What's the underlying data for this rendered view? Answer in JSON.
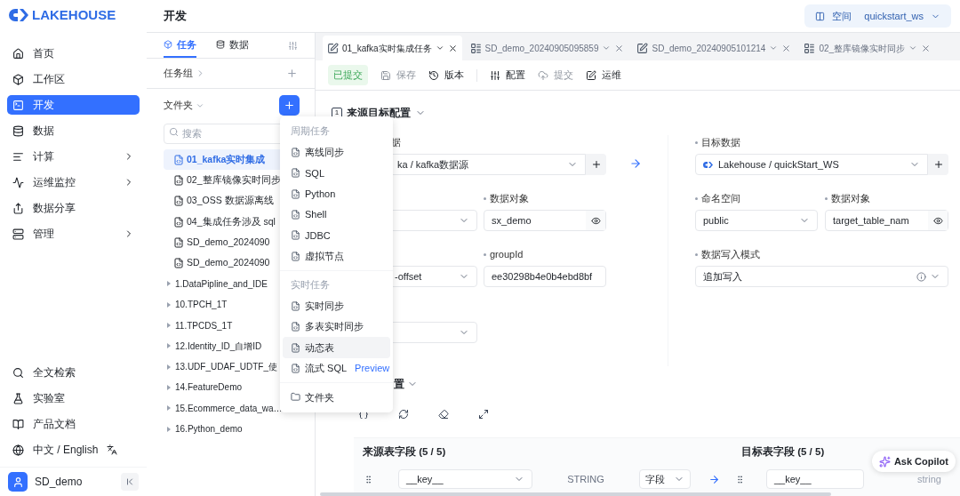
{
  "brand": {
    "name": "LAKEHOUSE"
  },
  "nav": [
    {
      "label": "首页",
      "selected": false,
      "submenu": false
    },
    {
      "label": "工作区",
      "selected": false,
      "submenu": false
    },
    {
      "label": "开发",
      "selected": true,
      "submenu": false
    },
    {
      "label": "数据",
      "selected": false,
      "submenu": false
    },
    {
      "label": "计算",
      "selected": false,
      "submenu": true
    },
    {
      "label": "运维监控",
      "selected": false,
      "submenu": true
    },
    {
      "label": "数据分享",
      "selected": false,
      "submenu": false
    },
    {
      "label": "管理",
      "selected": false,
      "submenu": true
    }
  ],
  "nav_bottom": [
    {
      "label": "全文检索"
    },
    {
      "label": "实验室"
    },
    {
      "label": "产品文档"
    },
    {
      "label": "中文 / English"
    }
  ],
  "user": {
    "name": "SD_demo"
  },
  "header": {
    "title": "开发",
    "space_label": "空间",
    "space_value": "quickstart_ws"
  },
  "panel_tabs": [
    {
      "label": "任务",
      "selected": true
    },
    {
      "label": "数据",
      "selected": false
    }
  ],
  "task_group": {
    "label": "任务组"
  },
  "folder": {
    "label": "文件夹"
  },
  "search": {
    "placeholder": "搜索"
  },
  "tree": [
    {
      "kind": "task",
      "label": "01_kafka实时集成",
      "selected": true
    },
    {
      "kind": "task",
      "label": "02_整库镜像实时同步",
      "selected": false
    },
    {
      "kind": "task",
      "label": "03_OSS 数据源离线",
      "selected": false
    },
    {
      "kind": "task",
      "label": "04_集成任务涉及 sql",
      "selected": false
    },
    {
      "kind": "task",
      "label": "SD_demo_2024090",
      "selected": false
    },
    {
      "kind": "task",
      "label": "SD_demo_2024090",
      "selected": false
    },
    {
      "kind": "folder",
      "label": "1.DataPipline_and_IDE",
      "selected": false
    },
    {
      "kind": "folder",
      "label": "10.TPCH_1T",
      "selected": false
    },
    {
      "kind": "folder",
      "label": "11.TPCDS_1T",
      "selected": false
    },
    {
      "kind": "folder",
      "label": "12.Identity_ID_自增ID",
      "selected": false
    },
    {
      "kind": "folder",
      "label": "13.UDF_UDAF_UDTF_使",
      "selected": false
    },
    {
      "kind": "folder",
      "label": "14.FeatureDemo",
      "selected": false
    },
    {
      "kind": "folder",
      "label": "15.Ecommerce_data_wa…",
      "selected": false
    },
    {
      "kind": "folder",
      "label": "16.Python_demo",
      "selected": false
    }
  ],
  "editor_tabs": [
    {
      "kind": "realtime",
      "label": "01_kafka实时集成任务",
      "selected": true
    },
    {
      "kind": "multi",
      "label": "SD_demo_20240905095859",
      "selected": false
    },
    {
      "kind": "realtime",
      "label": "SD_demo_20240905101214",
      "selected": false
    },
    {
      "kind": "multi",
      "label": "02_整库镜像实时同步",
      "selected": false
    }
  ],
  "toolbar": [
    {
      "kind": "status",
      "label": "已提交"
    },
    {
      "kind": "save",
      "label": "保存",
      "disabled": true
    },
    {
      "kind": "version",
      "label": "版本",
      "disabled": false
    },
    {
      "kind": "config",
      "label": "配置",
      "disabled": false
    },
    {
      "kind": "submit",
      "label": "提交",
      "disabled": true
    },
    {
      "kind": "ops",
      "label": "运维",
      "disabled": false
    }
  ],
  "section_1": {
    "number": "1",
    "title": "来源目标配置"
  },
  "source": {
    "label_fragment": "据",
    "datasource": "ka / kafka数据源",
    "object_label": "数据对象",
    "object_value": "sx_demo",
    "offset_value": "-offset",
    "group_label": "groupId",
    "group_value": "ee30298b4e0b4ebd8bf"
  },
  "target": {
    "label": "目标数据",
    "datasource": "Lakehouse / quickStart_WS",
    "namespace_label": "命名空间",
    "namespace_value": "public",
    "object_label": "数据对象",
    "object_value": "target_table_nam",
    "mode_label": "数据写入模式",
    "mode_value": "追加写入"
  },
  "section_2": {
    "title_fragment": "置"
  },
  "mapping": {
    "source_title": "来源表字段 (5 / 5)",
    "target_title": "目标表字段 (5 / 5)",
    "rows": [
      {
        "source_field": "__key__",
        "source_type": "STRING",
        "value_kind": "字段",
        "target_field": "__key__",
        "target_type": "string"
      }
    ]
  },
  "new_menu": {
    "groups": [
      {
        "title": "周期任务",
        "items": [
          {
            "label": "离线同步",
            "highlighted": false
          },
          {
            "label": "SQL",
            "highlighted": false
          },
          {
            "label": "Python",
            "highlighted": false
          },
          {
            "label": "Shell",
            "highlighted": false
          },
          {
            "label": "JDBC",
            "highlighted": false
          },
          {
            "label": "虚拟节点",
            "highlighted": false
          }
        ]
      },
      {
        "title": "实时任务",
        "items": [
          {
            "label": "实时同步",
            "highlighted": false
          },
          {
            "label": "多表实时同步",
            "highlighted": false
          },
          {
            "label": "动态表",
            "highlighted": true
          },
          {
            "label": "流式 SQL",
            "badge": "Preview",
            "highlighted": false
          }
        ]
      }
    ],
    "footer_item": {
      "label": "文件夹"
    }
  },
  "copilot": {
    "label": "Ask Copilot"
  }
}
